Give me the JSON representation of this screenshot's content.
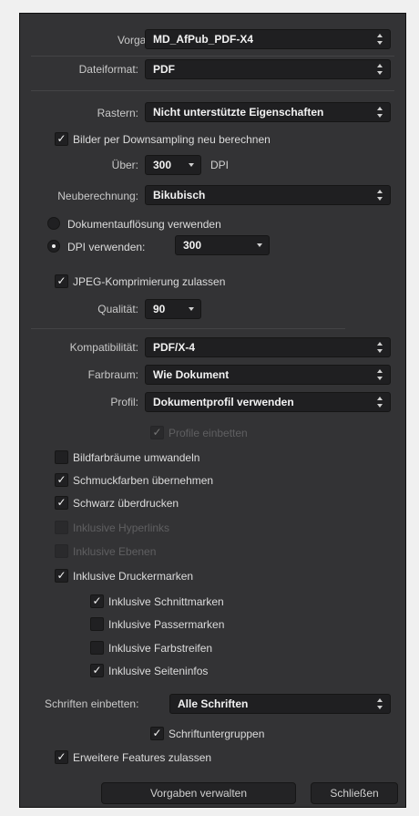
{
  "preset": {
    "label": "Vorgabe:",
    "value": "MD_AfPub_PDF-X4"
  },
  "file_format": {
    "label": "Dateiformat:",
    "value": "PDF"
  },
  "raster": {
    "label": "Rastern:",
    "value": "Nicht unterstützte Eigenschaften"
  },
  "downsample": {
    "label": "Bilder per Downsampling neu berechnen",
    "checked": true
  },
  "above": {
    "label": "Über:",
    "value": "300",
    "unit": "DPI"
  },
  "resample": {
    "label": "Neuberechnung:",
    "value": "Bikubisch"
  },
  "doc_resolution": {
    "label": "Dokumentauflösung verwenden",
    "selected": false
  },
  "use_dpi": {
    "label": "DPI verwenden:",
    "selected": true,
    "value": "300"
  },
  "jpeg": {
    "label": "JPEG-Komprimierung zulassen",
    "checked": true
  },
  "quality": {
    "label": "Qualität:",
    "value": "90"
  },
  "compat": {
    "label": "Kompatibilität:",
    "value": "PDF/X-4"
  },
  "colorspace": {
    "label": "Farbraum:",
    "value": "Wie Dokument"
  },
  "profile": {
    "label": "Profil:",
    "value": "Dokumentprofil verwenden"
  },
  "embed_profiles": {
    "label": "Profile einbetten",
    "checked": true,
    "enabled": false
  },
  "options": [
    {
      "label": "Bildfarbräume umwandeln",
      "checked": false,
      "enabled": true
    },
    {
      "label": "Schmuckfarben übernehmen",
      "checked": true,
      "enabled": true
    },
    {
      "label": "Schwarz überdrucken",
      "checked": true,
      "enabled": true
    },
    {
      "label": "Inklusive Hyperlinks",
      "checked": false,
      "enabled": false
    },
    {
      "label": "Inklusive Ebenen",
      "checked": false,
      "enabled": false
    },
    {
      "label": "Inklusive Druckermarken",
      "checked": true,
      "enabled": true
    }
  ],
  "marks": [
    {
      "label": "Inklusive Schnittmarken",
      "checked": true
    },
    {
      "label": "Inklusive Passermarken",
      "checked": false
    },
    {
      "label": "Inklusive Farbstreifen",
      "checked": false
    },
    {
      "label": "Inklusive Seiteninfos",
      "checked": true
    }
  ],
  "fonts": {
    "label": "Schriften einbetten:",
    "value": "Alle Schriften"
  },
  "subset": {
    "label": "Schriftuntergruppen",
    "checked": true
  },
  "advanced": {
    "label": "Erweitere Features zulassen",
    "checked": true
  },
  "buttons": {
    "manage": "Vorgaben verwalten",
    "close": "Schließen"
  },
  "check_glyph": "✓"
}
